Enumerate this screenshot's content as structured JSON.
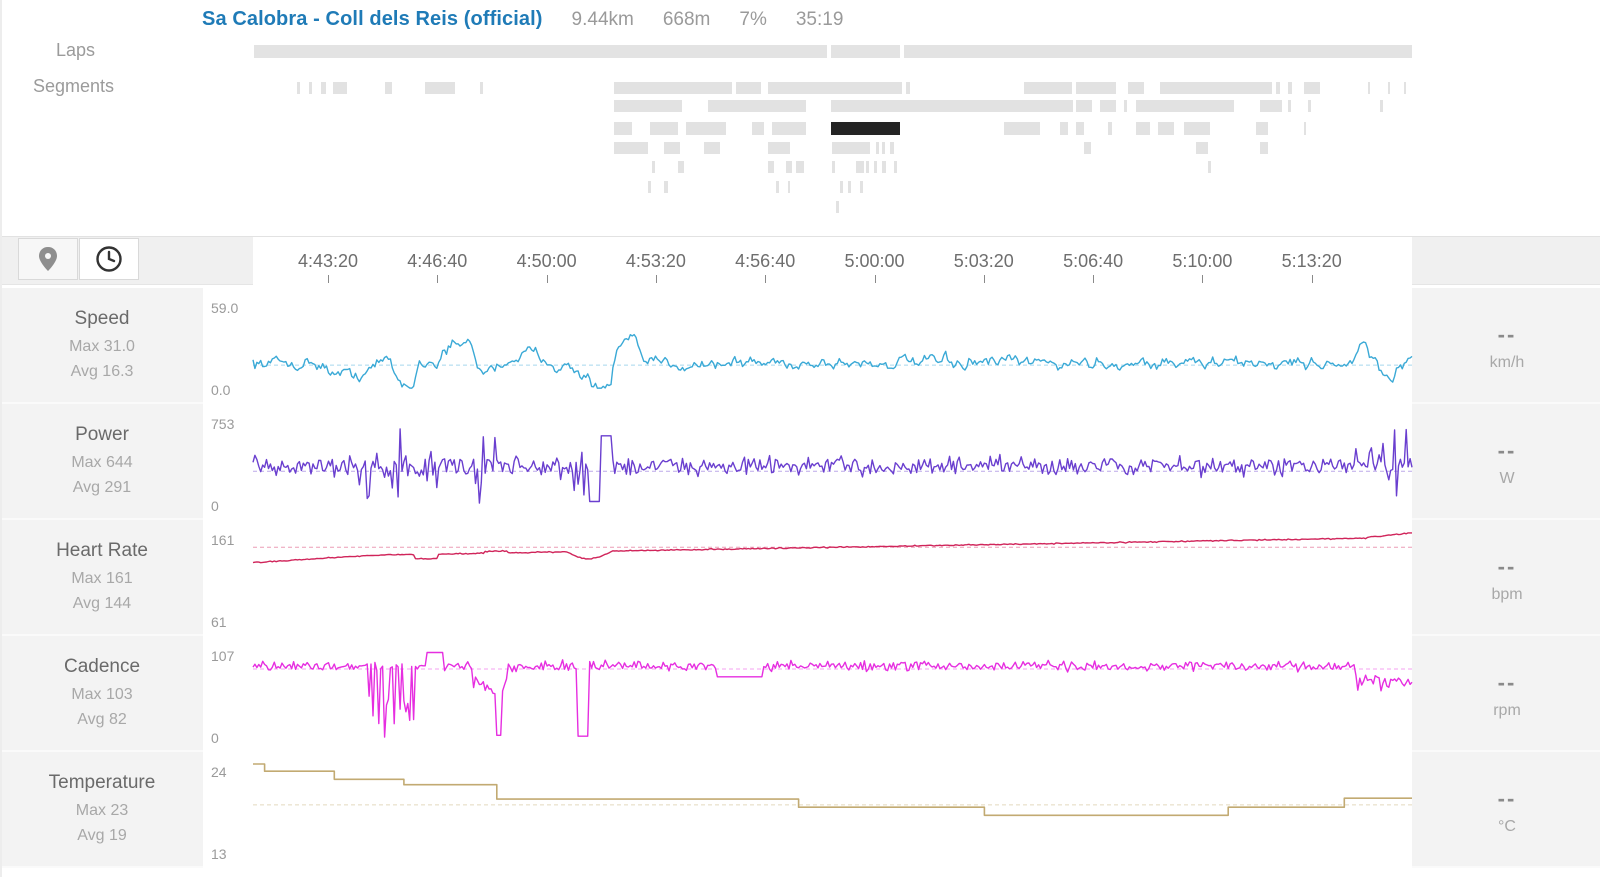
{
  "segment": {
    "name": "Sa Calobra - Coll dels Reis (official)",
    "distance": "9.44km",
    "elevation": "668m",
    "grade": "7%",
    "time": "35:19"
  },
  "labels": {
    "laps": "Laps",
    "segments": "Segments"
  },
  "toolbar": {
    "map_icon": "map-pin-icon",
    "time_icon": "clock-icon"
  },
  "time_axis": {
    "ticks": [
      "4:43:20",
      "4:46:40",
      "4:50:00",
      "4:53:20",
      "4:56:40",
      "5:00:00",
      "5:03:20",
      "5:06:40",
      "5:10:00",
      "5:13:20"
    ]
  },
  "metrics": [
    {
      "name": "Speed",
      "max": "Max 31.0",
      "avg": "Avg 16.3",
      "ytop": "59.0",
      "ybot": "0.0",
      "current": "--",
      "unit": "km/h",
      "color": "#3aa9d6",
      "avg_value": 16.3,
      "min_value": 0,
      "max_value": 59
    },
    {
      "name": "Power",
      "max": "Max 644",
      "avg": "Avg 291",
      "ytop": "753",
      "ybot": "0",
      "current": "--",
      "unit": "W",
      "color": "#6a3fcf",
      "avg_value": 291,
      "min_value": 0,
      "max_value": 753
    },
    {
      "name": "Heart Rate",
      "max": "Max 161",
      "avg": "Avg 144",
      "ytop": "161",
      "ybot": "61",
      "current": "--",
      "unit": "bpm",
      "color": "#d0245a",
      "avg_value": 144,
      "min_value": 61,
      "max_value": 161
    },
    {
      "name": "Cadence",
      "max": "Max 103",
      "avg": "Avg 82",
      "ytop": "107",
      "ybot": "0",
      "current": "--",
      "unit": "rpm",
      "color": "#e62ee0",
      "avg_value": 82,
      "min_value": 0,
      "max_value": 107
    },
    {
      "name": "Temperature",
      "max": "Max 23",
      "avg": "Avg 19",
      "ytop": "24",
      "ybot": "13",
      "current": "--",
      "unit": "°C",
      "color": "#c2aa72",
      "avg_value": 19,
      "min_value": 13,
      "max_value": 24
    }
  ]
}
